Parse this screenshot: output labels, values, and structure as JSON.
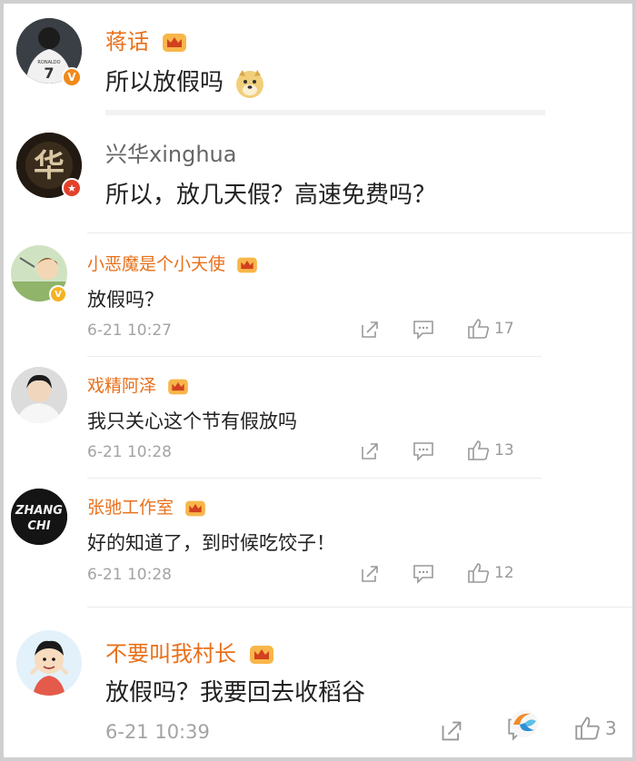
{
  "comments": [
    {
      "name": "蒋话",
      "text": "所以放假吗",
      "emoji": "doge"
    },
    {
      "name": "兴华xinghua",
      "text": "所以，放几天假？高速免费吗？"
    },
    {
      "name": "小恶魔是个小天使",
      "text": "放假吗？",
      "time": "6-21 10:27",
      "likes": "17"
    },
    {
      "name": "戏精阿泽",
      "text": "我只关心这个节有假放吗",
      "time": "6-21 10:28",
      "likes": "13"
    },
    {
      "name": "张驰工作室",
      "text": "好的知道了，到时候吃饺子！",
      "time": "6-21 10:28",
      "likes": "12"
    },
    {
      "name": "不要叫我村长",
      "text": "放假吗？我要回去收稻谷",
      "time": "6-21 10:39",
      "likes": "3"
    }
  ],
  "avatars": {
    "a1": "RONALDO 7",
    "a5": "ZHANG CHI"
  },
  "colors": {
    "orange": "#e8701a",
    "gray_text": "#a3a3a3",
    "badge_orange": "#f08a1c",
    "badge_red": "#e2412a"
  }
}
